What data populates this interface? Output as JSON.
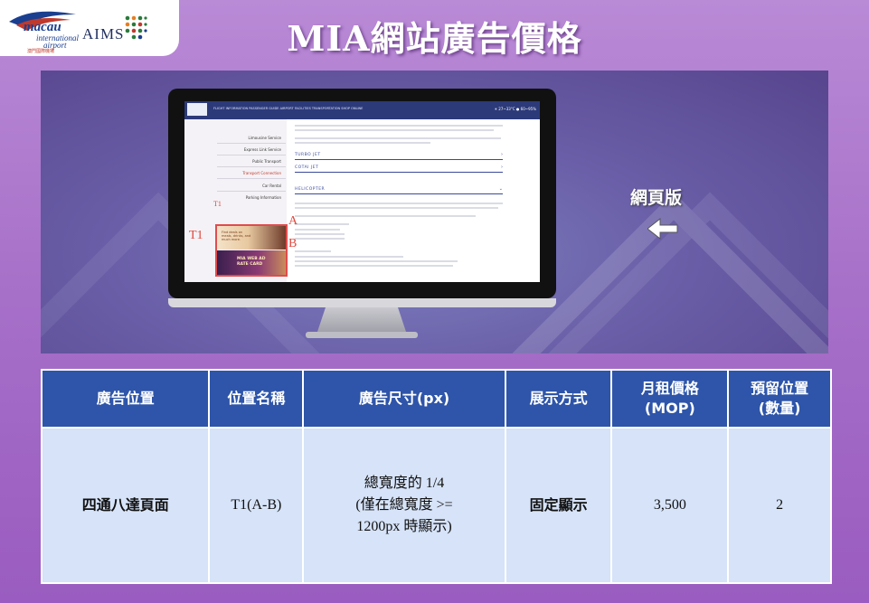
{
  "header": {
    "title": "MIA網站廣告價格",
    "logo_primary": "macau",
    "logo_secondary": "international",
    "logo_tertiary": "airport",
    "logo_chinese": "澳門國際機場",
    "partner_logo": "AIMS"
  },
  "preview": {
    "version_label": "網頁版",
    "arrow_icon": "left-arrow-icon",
    "tag_t1_small": "T1",
    "tag_t1": "T1",
    "tag_a": "A",
    "tag_b": "B",
    "screen": {
      "nav": "FLIGHT INFORMATION   PASSENGER GUIDE   AIRPORT FACILITIES   TRANSPORTATION   SHOP ONLINE",
      "weather": "☀ 27~33°C   ● 60~95%",
      "sidebar_items": [
        "Limousine Service",
        "Express Link Service",
        "Public Transport",
        "Transport Connection",
        "Car Rental",
        "Parking Information"
      ],
      "accordion": [
        "TURBO JET",
        "COTAI JET",
        "HELICOPTER"
      ],
      "ad_a_text": "Find deals on meals, drinks, and much more.",
      "ad_b_text_1": "MIA WEB AD",
      "ad_b_text_2": "RATE CARD"
    }
  },
  "table": {
    "headers": {
      "position": "廣告位置",
      "name": "位置名稱",
      "size": "廣告尺寸(px)",
      "display": "展示方式",
      "price_line1": "月租價格",
      "price_line2": "(MOP)",
      "reserve_line1": "預留位置",
      "reserve_line2": "(數量)"
    },
    "row": {
      "position": "四通八達頁面",
      "name": "T1(A-B)",
      "size_line1": "總寬度的 1/4",
      "size_line2": "(僅在總寬度 >=",
      "size_line3": "1200px 時顯示)",
      "display": "固定顯示",
      "price": "3,500",
      "reserve": "2"
    }
  },
  "colors": {
    "background": "#a66fc8",
    "table_header": "#2e55a9",
    "table_cell": "#d6e3f8",
    "accent_red": "#e0493f"
  }
}
